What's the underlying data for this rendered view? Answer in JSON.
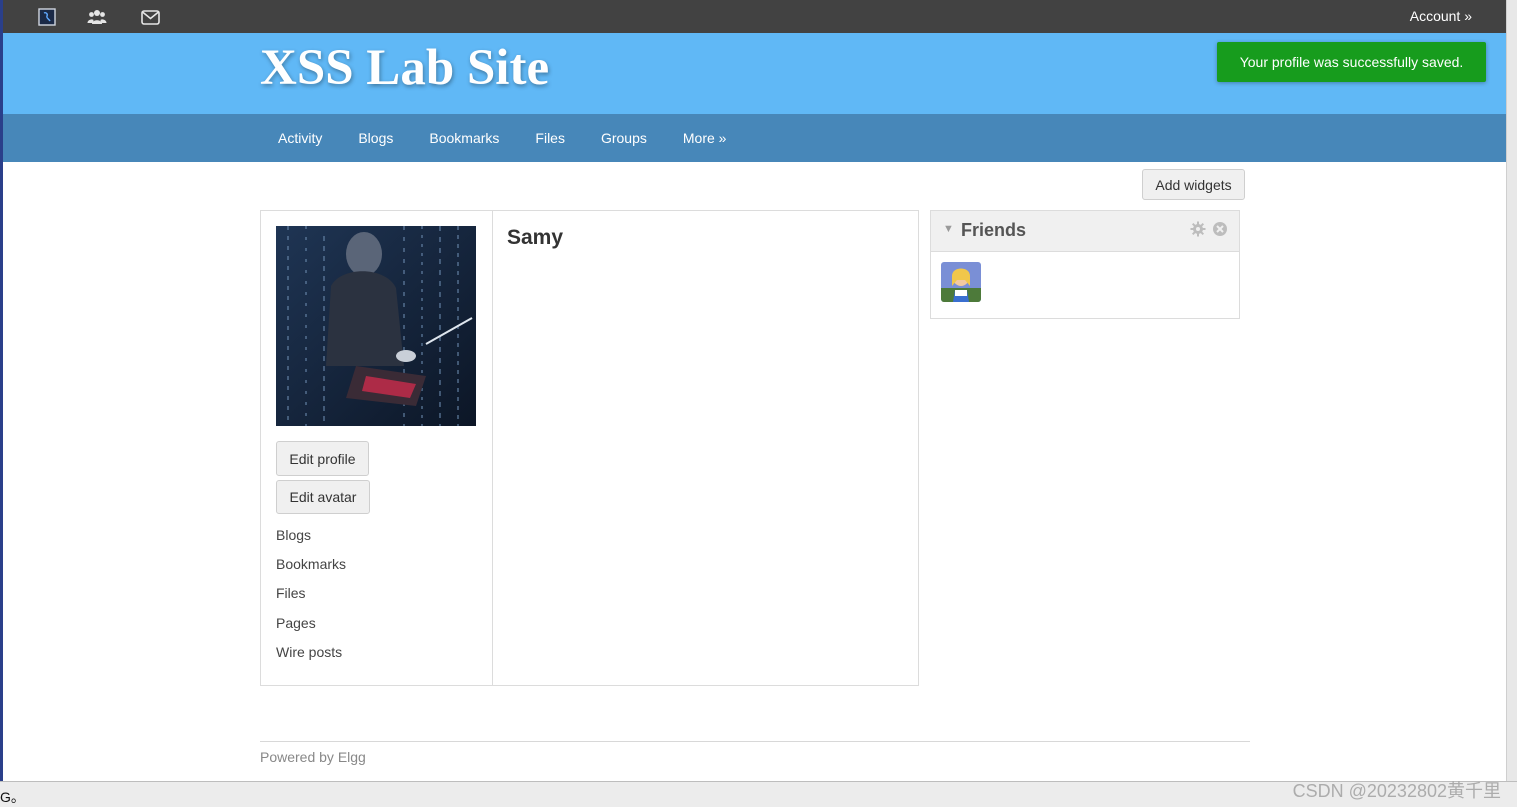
{
  "topbar": {
    "icons": [
      "elgg-logo-icon",
      "users-icon",
      "mail-icon"
    ],
    "account_label": "Account »"
  },
  "header": {
    "site_title": "XSS Lab Site",
    "flash_message": "Your profile was successfully saved."
  },
  "nav": {
    "items": [
      "Activity",
      "Blogs",
      "Bookmarks",
      "Files",
      "Groups",
      "More »"
    ]
  },
  "toolbar": {
    "add_widgets_label": "Add widgets"
  },
  "profile": {
    "name": "Samy",
    "edit_profile_label": "Edit profile",
    "edit_avatar_label": "Edit avatar",
    "menu": [
      "Blogs",
      "Bookmarks",
      "Files",
      "Pages",
      "Wire posts"
    ]
  },
  "friends_widget": {
    "title": "Friends",
    "icons": [
      "collapse-icon",
      "gear-icon",
      "close-icon"
    ]
  },
  "footer": {
    "text": "Powered by Elgg"
  },
  "statusbar": {
    "left_text": "G。"
  },
  "watermark": {
    "text": "CSDN @20232802黄千里"
  },
  "colors": {
    "topbar": "#424242",
    "header": "#60b8f6",
    "navbar": "#4787b9",
    "flash_success": "#179c1d"
  }
}
